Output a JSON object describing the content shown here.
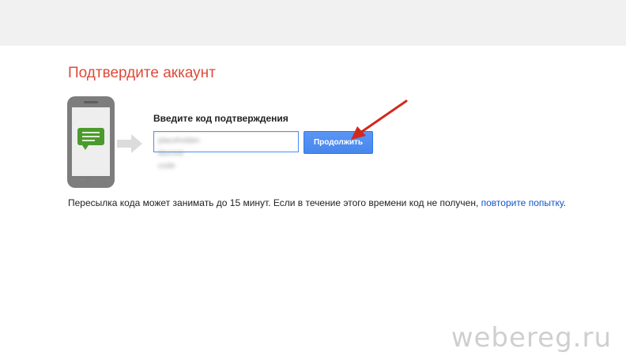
{
  "page": {
    "title": "Подтвердите аккаунт"
  },
  "form": {
    "code_label": "Введите код подтверждения",
    "code_value": "placeholder-blurred-code",
    "continue_label": "Продолжить"
  },
  "info": {
    "text": "Пересылка кода может занимать до 15 минут. Если в течение этого времени код не получен, ",
    "link_text": "повторите попытку",
    "trailing": "."
  },
  "watermark": "webereg.ru",
  "colors": {
    "title": "#dd4b39",
    "button": "#4787ed",
    "link": "#1155cc",
    "arrow": "#d2291e",
    "phone": "#7d7d7d",
    "message": "#4c9a2e"
  },
  "icons": {
    "phone": "phone-icon",
    "message": "message-icon",
    "arrow": "arrow-right-icon",
    "annotation": "annotation-arrow-icon"
  }
}
